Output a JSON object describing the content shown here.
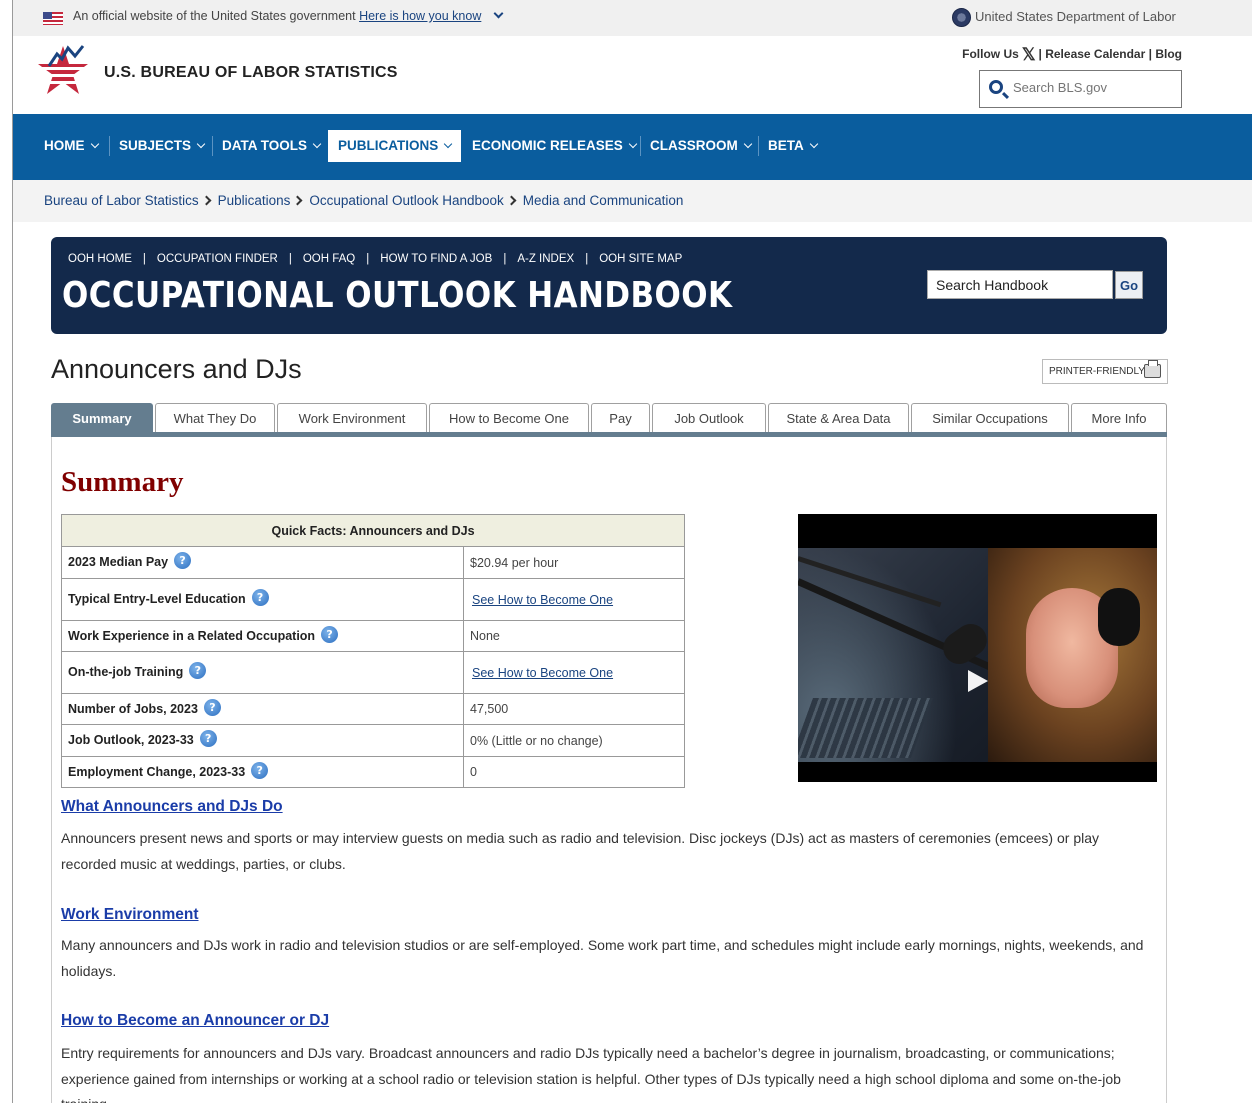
{
  "gov_banner": {
    "text": "An official website of the United States government",
    "link": "Here is how you know",
    "department": "United States Department of Labor"
  },
  "header": {
    "title": "U.S. BUREAU OF LABOR STATISTICS",
    "follow": "Follow Us",
    "x_glyph": "𝕏",
    "release_calendar": "Release Calendar",
    "blog": "Blog",
    "pipe": "|",
    "search_placeholder": "Search BLS.gov"
  },
  "nav": {
    "items": [
      {
        "label": "HOME"
      },
      {
        "label": "SUBJECTS"
      },
      {
        "label": "DATA TOOLS"
      },
      {
        "label": "PUBLICATIONS",
        "active": true
      },
      {
        "label": "ECONOMIC RELEASES"
      },
      {
        "label": "CLASSROOM"
      },
      {
        "label": "BETA"
      }
    ]
  },
  "breadcrumb": [
    "Bureau of Labor Statistics",
    "Publications",
    "Occupational Outlook Handbook",
    "Media and Communication"
  ],
  "ooh": {
    "links": [
      "OOH HOME",
      "OCCUPATION FINDER",
      "OOH FAQ",
      "HOW TO FIND A JOB",
      "A-Z INDEX",
      "OOH SITE MAP"
    ],
    "sep": "|",
    "title": "OCCUPATIONAL OUTLOOK HANDBOOK",
    "search_value": "Search Handbook",
    "go": "Go"
  },
  "occupation": {
    "title": "Announcers and DJs",
    "printer_friendly": "PRINTER-FRIENDLY"
  },
  "tabs": [
    "Summary",
    "What They Do",
    "Work Environment",
    "How to Become One",
    "Pay",
    "Job Outlook",
    "State & Area Data",
    "Similar Occupations",
    "More Info"
  ],
  "summary": {
    "heading": "Summary",
    "help_glyph": "?",
    "quick_facts": {
      "caption": "Quick Facts: Announcers and DJs",
      "rows": [
        {
          "label": "2023 Median Pay",
          "value": "$20.94 per hour"
        },
        {
          "label": "Typical Entry-Level Education",
          "value": "See How to Become One",
          "link": true
        },
        {
          "label": "Work Experience in a Related Occupation",
          "value": "None"
        },
        {
          "label": "On-the-job Training",
          "value": "See How to Become One",
          "link": true
        },
        {
          "label": "Number of Jobs, 2023",
          "value": "47,500"
        },
        {
          "label": "Job Outlook, 2023-33",
          "value": "0% (Little or no change)"
        },
        {
          "label": "Employment Change, 2023-33",
          "value": "0"
        }
      ]
    }
  },
  "sections": [
    {
      "heading": "What Announcers and DJs Do",
      "text": "Announcers present news and sports or may interview guests on media such as radio and television. Disc jockeys (DJs) act as masters of ceremonies (emcees) or play recorded music at weddings, parties, or clubs."
    },
    {
      "heading": "Work Environment",
      "text": "Many announcers and DJs work in radio and television studios or are self-employed. Some work part time, and schedules might include early mornings, nights, weekends, and holidays."
    },
    {
      "heading": "How to Become an Announcer or DJ",
      "text": "Entry requirements for announcers and DJs vary. Broadcast announcers and radio DJs typically need a bachelor’s degree in journalism, broadcasting, or communications; experience gained from internships or working at a school radio or television station is helpful. Other types of DJs typically need a high school diploma and some on-the-job training."
    }
  ],
  "colors": {
    "nav_blue": "#0a5d9e",
    "ooh_navy": "#13294b",
    "summary_red": "#800000",
    "tab_active": "#647d8f",
    "link_blue": "#1a3ca8"
  }
}
